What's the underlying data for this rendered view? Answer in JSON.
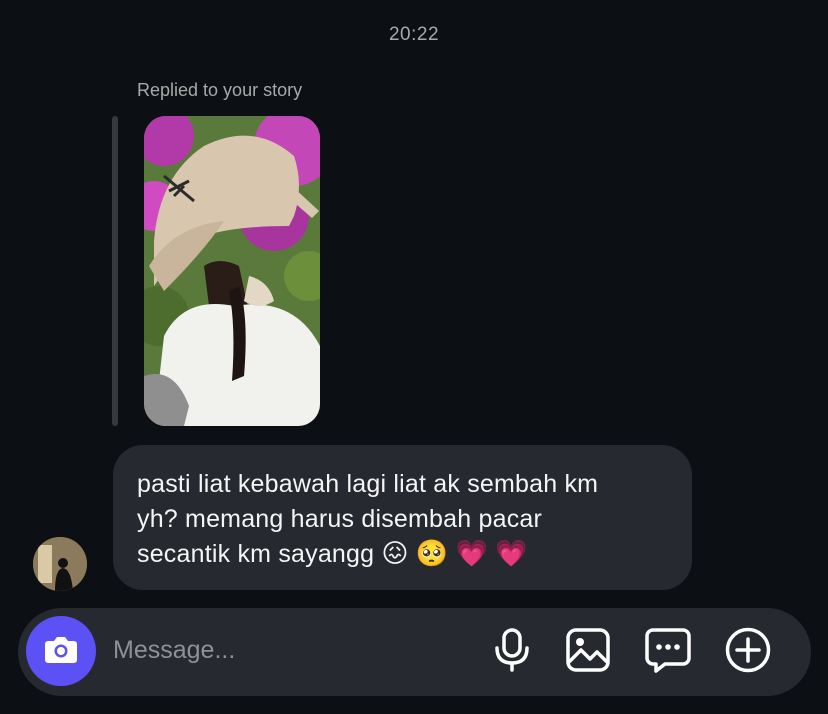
{
  "thread": {
    "timestamp": "20:22",
    "reply_context": "Replied to your story"
  },
  "message": {
    "lines": [
      "pasti liat kebawah lagi liat ak sembah km",
      "yh? memang harus disembah pacar",
      "secantik km sayangg"
    ],
    "emojis": [
      "😖",
      "🥺",
      "💗",
      "💗"
    ]
  },
  "composer": {
    "placeholder": "Message...",
    "icons": [
      "camera-icon",
      "microphone-icon",
      "gallery-icon",
      "sticker-icon",
      "plus-icon"
    ],
    "accent_color": "#5b51f5"
  },
  "colors": {
    "background": "#0c1014",
    "bubble": "#262a30",
    "muted_text": "#a8a8a8"
  }
}
